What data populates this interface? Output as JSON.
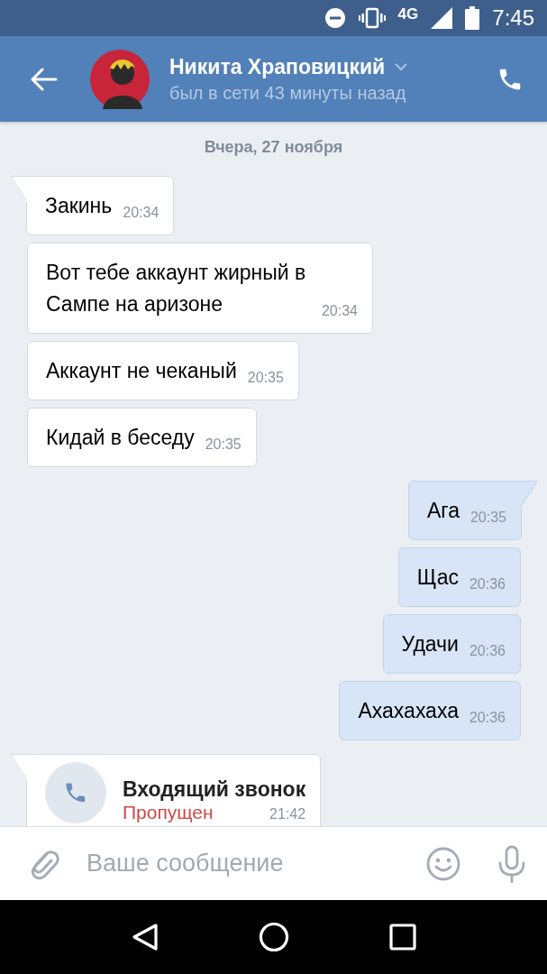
{
  "status_bar": {
    "network": "4G",
    "time": "7:45"
  },
  "header": {
    "name": "Никита Храповицкий",
    "status": "был в сети 43 минуты назад"
  },
  "date": "Вчера, 27 ноября",
  "messages": [
    {
      "kind": "in",
      "tail": true,
      "text": "Закинь",
      "time": "20:34"
    },
    {
      "kind": "in",
      "tail": false,
      "text": "Вот тебе аккаунт жирный в Сампе на аризоне",
      "time": "20:34"
    },
    {
      "kind": "in",
      "tail": false,
      "text": "Аккаунт не чеканый",
      "time": "20:35"
    },
    {
      "kind": "in",
      "tail": false,
      "text": "Кидай в беседу",
      "time": "20:35"
    },
    {
      "kind": "out",
      "tail": true,
      "text": "Ага",
      "time": "20:35"
    },
    {
      "kind": "out",
      "tail": false,
      "text": "Щас",
      "time": "20:36"
    },
    {
      "kind": "out",
      "tail": false,
      "text": "Удачи",
      "time": "20:36"
    },
    {
      "kind": "out",
      "tail": false,
      "text": "Ахахахаха",
      "time": "20:36"
    },
    {
      "kind": "call",
      "tail": true,
      "title": "Входящий звонок",
      "status": "Пропущен",
      "time": "21:42"
    }
  ],
  "composer": {
    "placeholder": "Ваше сообщение"
  }
}
